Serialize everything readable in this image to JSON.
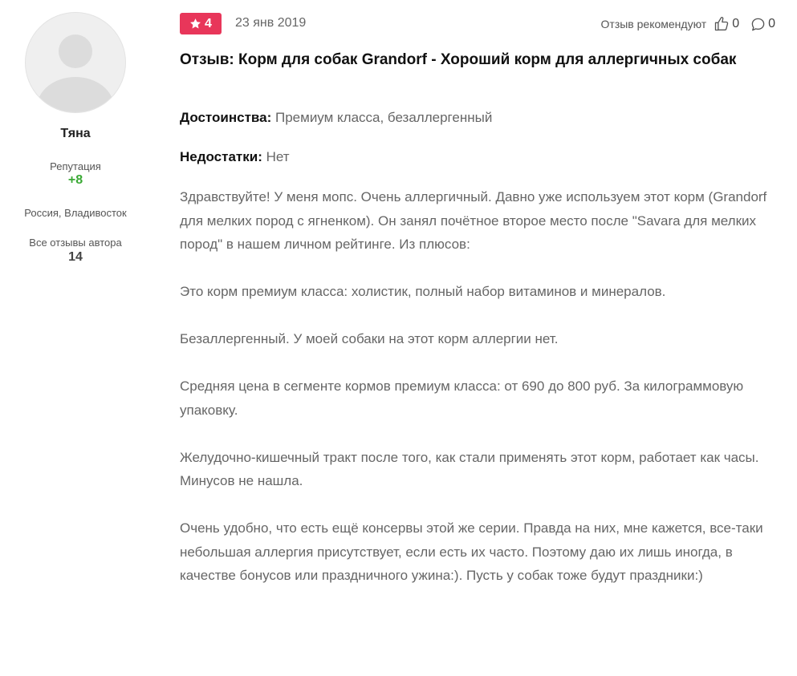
{
  "author": {
    "name": "Тяна",
    "reputation_label": "Репутация",
    "reputation_value": "+8",
    "location": "Россия, Владивосток",
    "all_reviews_label": "Все отзывы автора",
    "all_reviews_count": "14"
  },
  "review": {
    "rating": "4",
    "date": "23 янв 2019",
    "recommend_label": "Отзыв рекомендуют",
    "likes_count": "0",
    "comments_count": "0",
    "title": "Отзыв: Корм для собак Grandorf - Хороший корм для аллергичных собак",
    "pros_label": "Достоинства:",
    "pros_value": "Премиум класса, безаллергенный",
    "cons_label": "Недостатки:",
    "cons_value": "Нет",
    "paragraphs": [
      "Здравствуйте! У меня мопс. Очень аллергичный. Давно уже используем этот корм (Grandorf для мелких пород с ягненком). Он занял почётное второе место после \"Savara для мелких пород\" в нашем личном рейтинге. Из плюсов:",
      "Это корм премиум класса: холистик, полный набор витаминов и минералов.",
      "Безаллергенный. У моей собаки на этот корм аллергии нет.",
      "Средняя цена в сегменте кормов премиум класса: от 690 до 800 руб. За килограммовую упаковку.",
      "Желудочно-кишечный тракт после того, как стали применять этот корм, работает как часы. Минусов не нашла.",
      "Очень удобно, что есть ещё консервы этой же серии. Правда на них, мне кажется, все-таки небольшая аллергия присутствует, если есть их часто. Поэтому даю их лишь иногда, в качестве бонусов или праздничного ужина:). Пусть у собак тоже будут праздники:)"
    ]
  },
  "icons": {
    "avatar": "default-user-avatar",
    "rating": "star-icon",
    "like": "thumbs-up-icon",
    "comment": "comment-icon"
  },
  "colors": {
    "rating_badge": "#e8365a",
    "reputation": "#3aa935",
    "avatar_bg": "#efefef",
    "avatar_figure": "#dcdcdc"
  }
}
